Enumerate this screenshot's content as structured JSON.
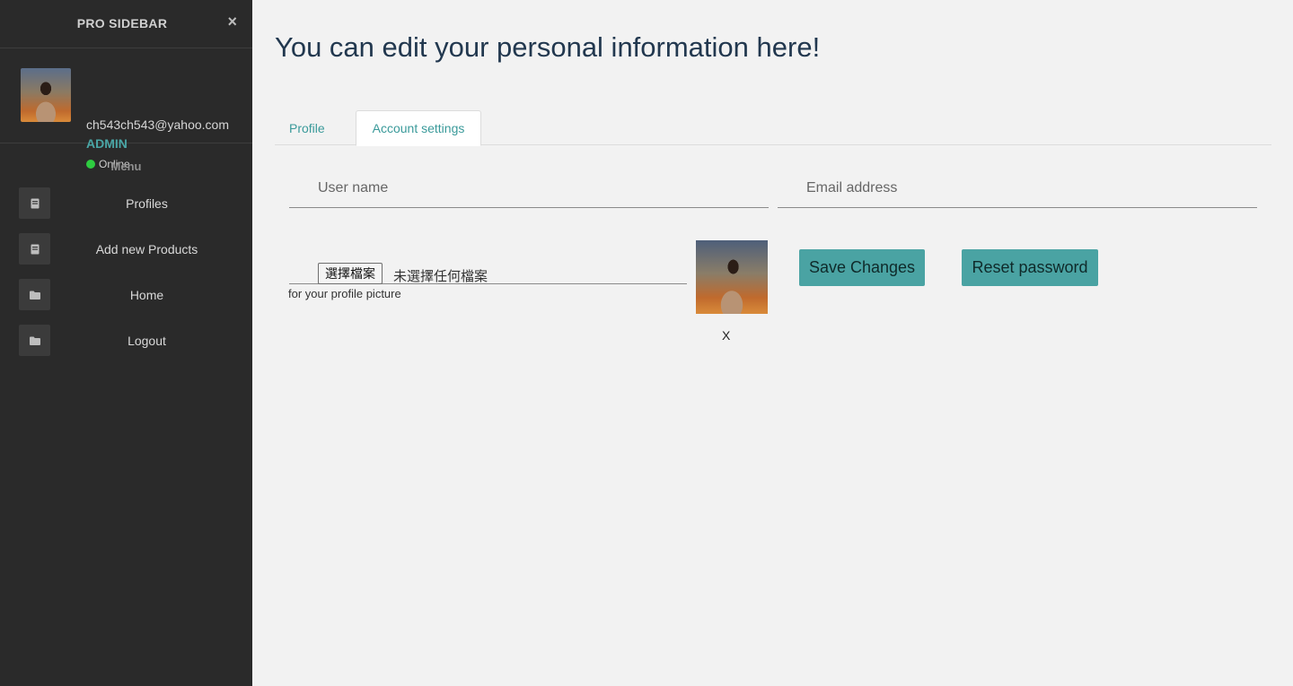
{
  "sidebar": {
    "brand": "PRO SIDEBAR",
    "close_glyph": "×",
    "user": {
      "email": "ch543ch543@yahoo.com",
      "role": "ADMIN",
      "status": "Online"
    },
    "menu_heading": "Menu",
    "items": [
      {
        "label": "Profiles",
        "icon": "book-icon"
      },
      {
        "label": "Add new Products",
        "icon": "book-icon"
      },
      {
        "label": "Home",
        "icon": "folder-icon"
      },
      {
        "label": "Logout",
        "icon": "folder-icon"
      }
    ]
  },
  "main": {
    "title": "You can edit your personal information here!",
    "tabs": [
      {
        "label": "Profile",
        "active": false
      },
      {
        "label": "Account settings",
        "active": true
      }
    ],
    "form": {
      "username_placeholder": "User name",
      "email_placeholder": "Email address",
      "file_button": "選擇檔案",
      "file_status": "未選擇任何檔案",
      "file_hint": "for your profile picture",
      "remove_label": "X",
      "save_label": "Save Changes",
      "reset_label": "Reset password"
    }
  },
  "colors": {
    "sidebar_bg": "#2a2a2a",
    "accent": "#4aa3a3",
    "page_bg": "#f2f2f2",
    "title": "#22384f",
    "online": "#2ecc40"
  }
}
